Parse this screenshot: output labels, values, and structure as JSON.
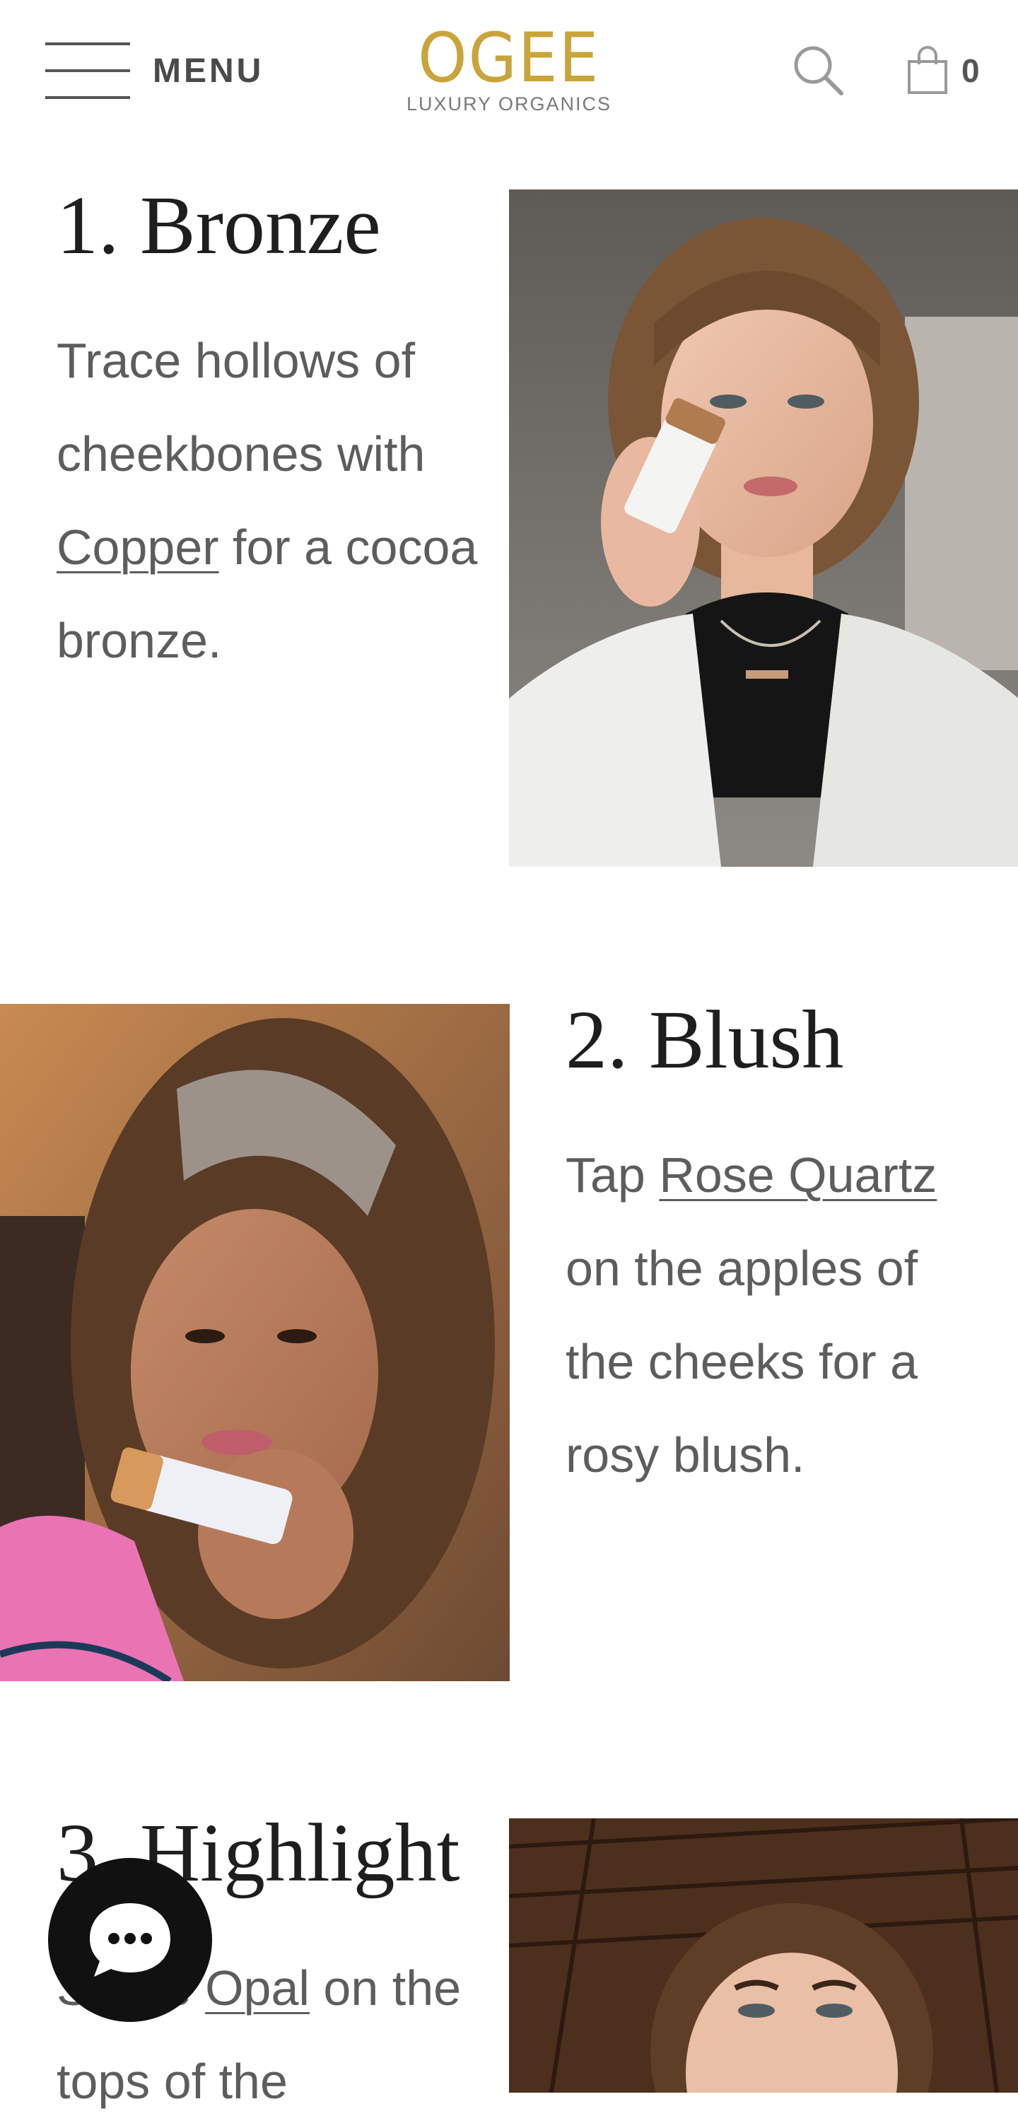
{
  "header": {
    "menu_label": "MENU",
    "logo_word": "OGEE",
    "logo_sub": "LUXURY ORGANICS",
    "cart_count": "0"
  },
  "colors": {
    "logo_gold": "#c9a43a",
    "heading": "#1e1e1e",
    "body_text": "#5d5d5d",
    "chat_bg": "#111111"
  },
  "steps": [
    {
      "title": "1. Bronze",
      "text_before": "Trace hollows of cheekbones with ",
      "link": "Copper",
      "text_after": " for a cocoa bronze.",
      "photo": "woman-with-bangs-holding-copper-stick"
    },
    {
      "title": "2. Blush",
      "text_before": "Tap ",
      "link": "Rose Quartz",
      "text_after": " on the apples of the cheeks for a rosy blush.",
      "photo": "woman-with-gray-streak-holding-rose-quartz-stick"
    },
    {
      "title": "3. Highlight",
      "text_before": "Swipe ",
      "link": "Opal",
      "text_after": " on the tops of the",
      "photo": "woman-under-wood-ceiling-applying-opal"
    }
  ],
  "icons": {
    "menu": "hamburger-icon",
    "search": "search-icon",
    "cart": "shopping-bag-icon",
    "chat": "chat-bubble-icon"
  }
}
